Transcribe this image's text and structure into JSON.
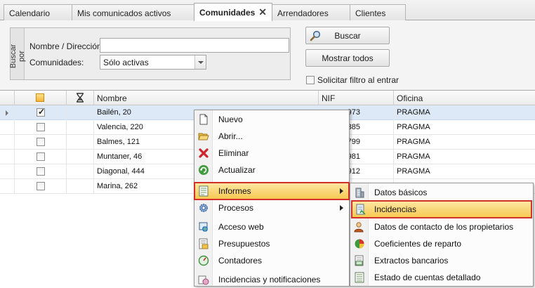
{
  "tabs": [
    {
      "label": "Calendario"
    },
    {
      "label": "Mis comunicados activos"
    },
    {
      "label": "Comunidades",
      "close": "✕"
    },
    {
      "label": "Arrendadores"
    },
    {
      "label": "Clientes"
    }
  ],
  "search": {
    "group_label": "Buscar por",
    "name_label": "Nombre / Dirección:",
    "name_value": "",
    "comunidades_label": "Comunidades:",
    "comunidades_value": "Sólo activas",
    "buscar_button": "Buscar",
    "mostrar_button": "Mostrar todos",
    "solicitar_label": "Solicitar filtro al entrar"
  },
  "grid": {
    "columns": [
      "Nombre",
      "NIF",
      "Oficina"
    ],
    "rows": [
      {
        "nombre": "Bailén, 20",
        "nif": "973",
        "oficina": "PRAGMA",
        "checked": true
      },
      {
        "nombre": "Valencia, 220",
        "nif": "385",
        "oficina": "PRAGMA",
        "checked": false
      },
      {
        "nombre": "Balmes, 121",
        "nif": "799",
        "oficina": "PRAGMA",
        "checked": false
      },
      {
        "nombre": "Muntaner, 46",
        "nif": "981",
        "oficina": "PRAGMA",
        "checked": false
      },
      {
        "nombre": "Diagonal, 444",
        "nif": "912",
        "oficina": "PRAGMA",
        "checked": false
      },
      {
        "nombre": "Marina, 262",
        "nif": "",
        "oficina": "",
        "checked": false
      }
    ]
  },
  "context_menu": {
    "items": [
      {
        "label": "Nuevo",
        "icon": "new-document-icon"
      },
      {
        "label": "Abrir...",
        "icon": "open-folder-icon"
      },
      {
        "label": "Eliminar",
        "icon": "delete-icon"
      },
      {
        "label": "Actualizar",
        "icon": "refresh-icon"
      },
      {
        "label": "Informes",
        "icon": "report-icon"
      },
      {
        "label": "Procesos",
        "icon": "gear-icon"
      },
      {
        "label": "Acceso web",
        "icon": "web-access-icon"
      },
      {
        "label": "Presupuestos",
        "icon": "budget-icon"
      },
      {
        "label": "Contadores",
        "icon": "meter-icon"
      },
      {
        "label": "Incidencias y notificaciones",
        "icon": "notifications-icon"
      }
    ]
  },
  "submenu": {
    "items": [
      {
        "label": "Datos básicos",
        "icon": "building-icon"
      },
      {
        "label": "Incidencias",
        "icon": "incidents-icon"
      },
      {
        "label": "Datos de contacto de los propietarios",
        "icon": "owner-contact-icon"
      },
      {
        "label": "Coeficientes de reparto",
        "icon": "pie-chart-icon"
      },
      {
        "label": "Extractos bancarios",
        "icon": "bank-statement-icon"
      },
      {
        "label": "Estado de cuentas detallado",
        "icon": "account-statement-icon"
      }
    ]
  },
  "colors": {
    "highlight": "#f6c84f",
    "highlight_border": "#d2302a",
    "selected_row": "#dde9f6"
  }
}
